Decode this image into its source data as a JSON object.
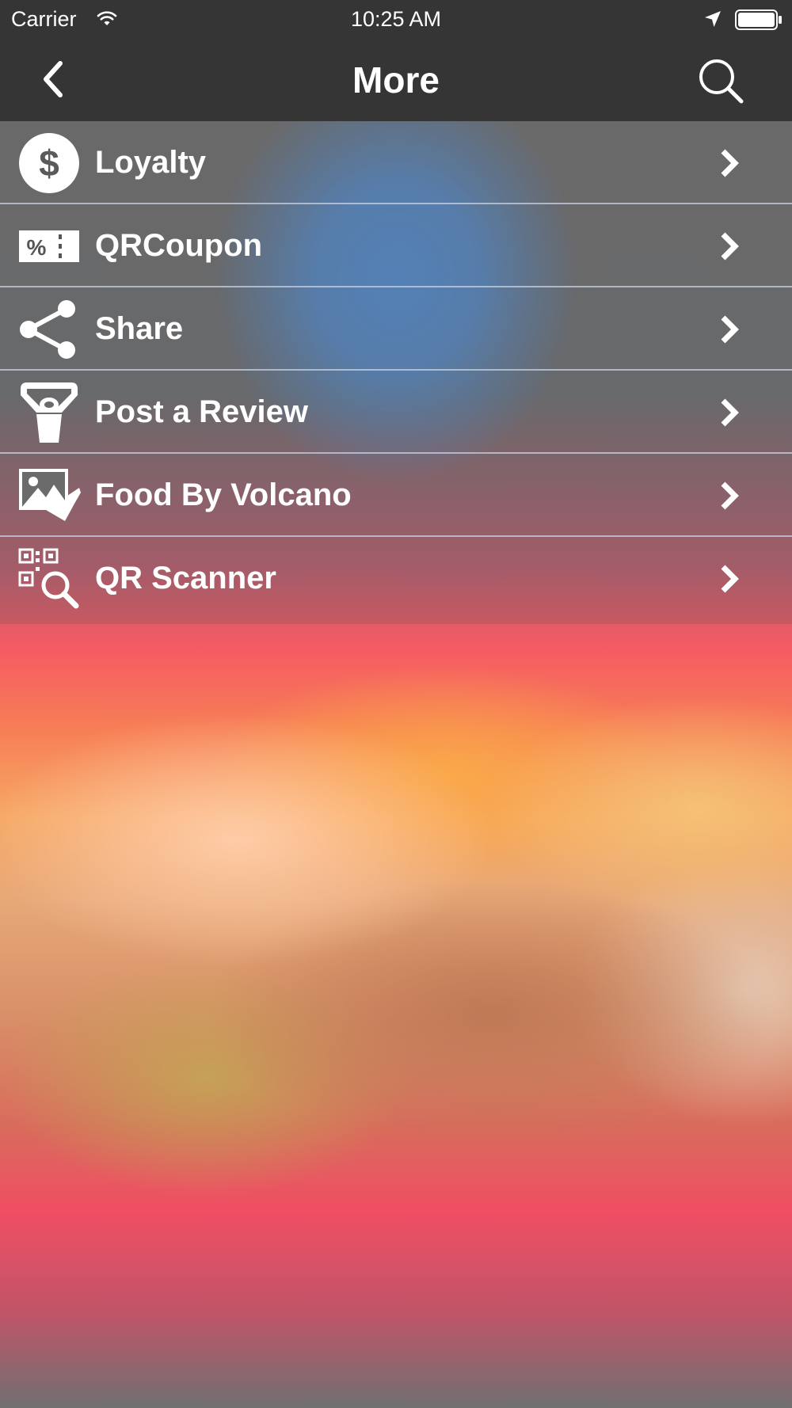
{
  "status_bar": {
    "carrier": "Carrier",
    "time": "10:25 AM"
  },
  "nav": {
    "title": "More"
  },
  "menu": {
    "items": [
      {
        "label": "Loyalty",
        "icon": "dollar-coin-icon"
      },
      {
        "label": "QRCoupon",
        "icon": "coupon-ticket-icon"
      },
      {
        "label": "Share",
        "icon": "share-icon"
      },
      {
        "label": "Post a Review",
        "icon": "review-person-icon"
      },
      {
        "label": "Food By Volcano",
        "icon": "photo-gallery-icon"
      },
      {
        "label": "QR Scanner",
        "icon": "qr-scanner-icon"
      }
    ]
  },
  "colors": {
    "bar": "#353535",
    "text": "#ffffff"
  }
}
